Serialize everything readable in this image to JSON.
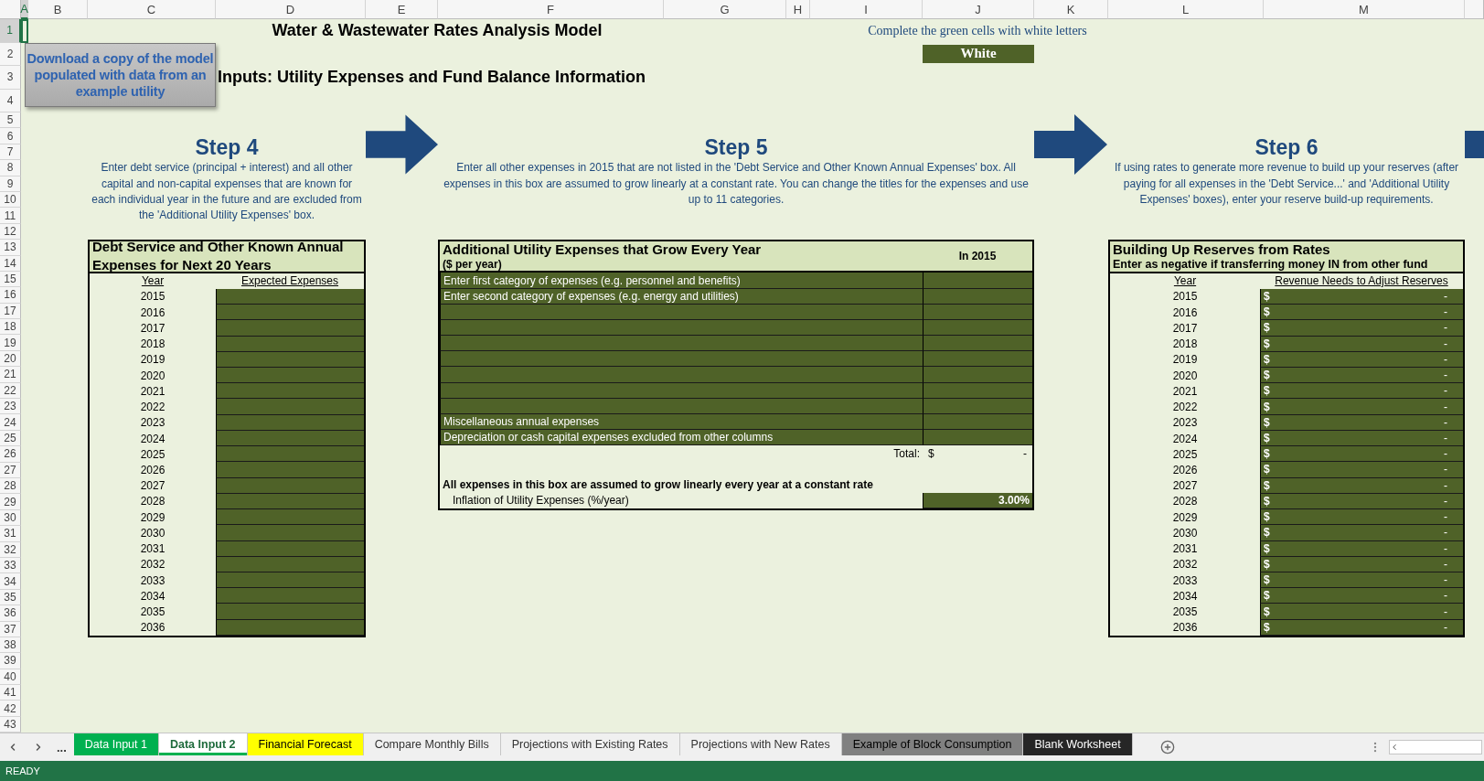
{
  "column_headers": [
    {
      "label": "A",
      "selected": true
    },
    {
      "label": "B",
      "selected": false
    },
    {
      "label": "C",
      "selected": false
    },
    {
      "label": "D",
      "selected": false
    },
    {
      "label": "E",
      "selected": false
    },
    {
      "label": "F",
      "selected": false
    },
    {
      "label": "G",
      "selected": false
    },
    {
      "label": "H",
      "selected": false
    },
    {
      "label": "I",
      "selected": false
    },
    {
      "label": "J",
      "selected": false
    },
    {
      "label": "K",
      "selected": false
    },
    {
      "label": "L",
      "selected": false
    },
    {
      "label": "M",
      "selected": false
    }
  ],
  "row_headers": [
    {
      "label": "1",
      "selected": true
    },
    {
      "label": "2",
      "selected": false
    },
    {
      "label": "3",
      "selected": false
    },
    {
      "label": "4",
      "selected": false
    },
    {
      "label": "5",
      "selected": false
    },
    {
      "label": "6",
      "selected": false
    },
    {
      "label": "7",
      "selected": false
    },
    {
      "label": "8",
      "selected": false
    },
    {
      "label": "9",
      "selected": false
    },
    {
      "label": "10",
      "selected": false
    },
    {
      "label": "11",
      "selected": false
    },
    {
      "label": "12",
      "selected": false
    },
    {
      "label": "13",
      "selected": false
    },
    {
      "label": "14",
      "selected": false
    },
    {
      "label": "15",
      "selected": false
    },
    {
      "label": "16",
      "selected": false
    },
    {
      "label": "17",
      "selected": false
    },
    {
      "label": "18",
      "selected": false
    },
    {
      "label": "19",
      "selected": false
    },
    {
      "label": "20",
      "selected": false
    },
    {
      "label": "21",
      "selected": false
    },
    {
      "label": "22",
      "selected": false
    },
    {
      "label": "23",
      "selected": false
    },
    {
      "label": "24",
      "selected": false
    },
    {
      "label": "25",
      "selected": false
    },
    {
      "label": "26",
      "selected": false
    },
    {
      "label": "27",
      "selected": false
    },
    {
      "label": "28",
      "selected": false
    },
    {
      "label": "29",
      "selected": false
    },
    {
      "label": "30",
      "selected": false
    },
    {
      "label": "31",
      "selected": false
    },
    {
      "label": "32",
      "selected": false
    },
    {
      "label": "33",
      "selected": false
    },
    {
      "label": "34",
      "selected": false
    },
    {
      "label": "35",
      "selected": false
    },
    {
      "label": "36",
      "selected": false
    },
    {
      "label": "37",
      "selected": false
    },
    {
      "label": "38",
      "selected": false
    },
    {
      "label": "39",
      "selected": false
    },
    {
      "label": "40",
      "selected": false
    },
    {
      "label": "41",
      "selected": false
    },
    {
      "label": "42",
      "selected": false
    },
    {
      "label": "43",
      "selected": false
    }
  ],
  "title": "Water & Wastewater Rates Analysis Model",
  "instruction": "Complete the green cells with white letters",
  "legend_cell": "White",
  "download_button": "Download a copy of the model populated with data from an example utility",
  "section_title": "Inputs: Utility Expenses and Fund Balance Information",
  "steps": [
    {
      "heading": "Step 4",
      "text": "Enter debt service (principal + interest) and all other capital and non-capital expenses that are known for each individual year in the future and are excluded from the 'Additional Utility Expenses' box."
    },
    {
      "heading": "Step 5",
      "text": "Enter all other expenses in 2015 that are not listed in the 'Debt Service and Other Known Annual Expenses' box. All expenses in this box are assumed to grow linearly at a constant rate. You can change the titles for the expenses and use up to 11 categories."
    },
    {
      "heading": "Step 6",
      "text": "If using rates to generate more revenue to build up your reserves (after paying for all expenses in the 'Debt Service...' and 'Additional Utility Expenses' boxes), enter your reserve build-up requirements."
    }
  ],
  "debt_table": {
    "title": "Debt Service and Other Known Annual Expenses for Next 20 Years",
    "year_header": "Year",
    "value_header": "Expected Expenses",
    "years": [
      "2015",
      "2016",
      "2017",
      "2018",
      "2019",
      "2020",
      "2021",
      "2022",
      "2023",
      "2024",
      "2025",
      "2026",
      "2027",
      "2028",
      "2029",
      "2030",
      "2031",
      "2032",
      "2033",
      "2034",
      "2035",
      "2036"
    ]
  },
  "expenses_table": {
    "title": "Additional Utility Expenses that Grow Every Year",
    "subtitle": "($ per year)",
    "value_header": "In 2015",
    "rows": [
      {
        "kind": "labeled",
        "label": "Enter first category of expenses (e.g. personnel and benefits)"
      },
      {
        "kind": "labeled",
        "label": "Enter second category of expenses (e.g. energy and utilities)"
      },
      {
        "kind": "blank"
      },
      {
        "kind": "blank"
      },
      {
        "kind": "blank"
      },
      {
        "kind": "blank"
      },
      {
        "kind": "blank"
      },
      {
        "kind": "blank"
      },
      {
        "kind": "blank"
      },
      {
        "kind": "labeled",
        "label": "Miscellaneous annual expenses"
      },
      {
        "kind": "labeled",
        "label": "Depreciation or cash capital expenses excluded from other columns"
      }
    ],
    "total_label": "Total:",
    "total_currency": "$",
    "total_value": "-",
    "note": "All expenses in this box are assumed to grow linearly every year at a constant rate",
    "rate_label": "Inflation of Utility Expenses (%/year)",
    "rate_value": "3.00%"
  },
  "reserves_table": {
    "title": "Building Up Reserves from Rates",
    "subtitle": "Enter as negative if transferring money IN from other fund",
    "year_header": "Year",
    "value_header": "Revenue Needs to Adjust Reserves",
    "rows": [
      {
        "year": "2015",
        "currency": "$",
        "value": "-"
      },
      {
        "year": "2016",
        "currency": "$",
        "value": "-"
      },
      {
        "year": "2017",
        "currency": "$",
        "value": "-"
      },
      {
        "year": "2018",
        "currency": "$",
        "value": "-"
      },
      {
        "year": "2019",
        "currency": "$",
        "value": "-"
      },
      {
        "year": "2020",
        "currency": "$",
        "value": "-"
      },
      {
        "year": "2021",
        "currency": "$",
        "value": "-"
      },
      {
        "year": "2022",
        "currency": "$",
        "value": "-"
      },
      {
        "year": "2023",
        "currency": "$",
        "value": "-"
      },
      {
        "year": "2024",
        "currency": "$",
        "value": "-"
      },
      {
        "year": "2025",
        "currency": "$",
        "value": "-"
      },
      {
        "year": "2026",
        "currency": "$",
        "value": "-"
      },
      {
        "year": "2027",
        "currency": "$",
        "value": "-"
      },
      {
        "year": "2028",
        "currency": "$",
        "value": "-"
      },
      {
        "year": "2029",
        "currency": "$",
        "value": "-"
      },
      {
        "year": "2030",
        "currency": "$",
        "value": "-"
      },
      {
        "year": "2031",
        "currency": "$",
        "value": "-"
      },
      {
        "year": "2032",
        "currency": "$",
        "value": "-"
      },
      {
        "year": "2033",
        "currency": "$",
        "value": "-"
      },
      {
        "year": "2034",
        "currency": "$",
        "value": "-"
      },
      {
        "year": "2035",
        "currency": "$",
        "value": "-"
      },
      {
        "year": "2036",
        "currency": "$",
        "value": "-"
      }
    ]
  },
  "tabs_more": "...",
  "sheet_tabs": [
    {
      "label": "Data Input 1",
      "selected": false,
      "color": "#00b050"
    },
    {
      "label": "Data Input 2",
      "selected": true,
      "color": "#00b050"
    },
    {
      "label": "Financial Forecast",
      "selected": false,
      "color": "#ffff00"
    },
    {
      "label": "Compare Monthly Bills",
      "selected": false
    },
    {
      "label": "Projections with Existing Rates",
      "selected": false
    },
    {
      "label": "Projections with New Rates",
      "selected": false
    },
    {
      "label": "Example of Block Consumption",
      "selected": false,
      "color": "#808080"
    },
    {
      "label": "Blank Worksheet",
      "selected": false,
      "color": "#262626"
    }
  ],
  "status": "READY"
}
